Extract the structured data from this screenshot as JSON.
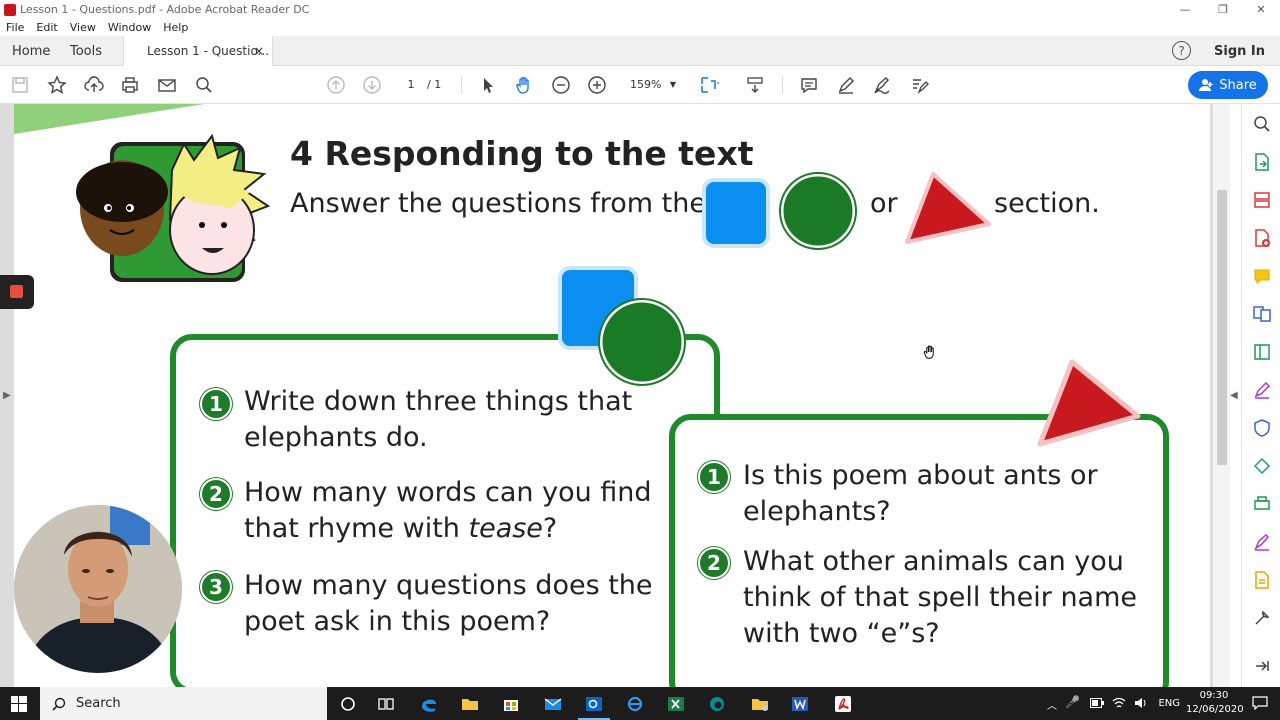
{
  "window": {
    "title": "Lesson 1 - Questions.pdf - Adobe Acrobat Reader DC",
    "minimize": "—",
    "restore": "❐",
    "close": "✕"
  },
  "menu": [
    "File",
    "Edit",
    "View",
    "Window",
    "Help"
  ],
  "tabs": {
    "home": "Home",
    "tools": "Tools",
    "document": "Lesson 1 - Questio...",
    "close": "×",
    "help": "?",
    "signin": "Sign In"
  },
  "toolbar": {
    "page_current": "1",
    "page_total": "/ 1",
    "zoom": "159%",
    "share_label": "Share"
  },
  "document": {
    "heading": "4 Responding to the text",
    "instruction": "Answer the questions from the",
    "instruction_or": "or",
    "instruction_end": "section.",
    "left_card": {
      "questions": [
        {
          "num": "1",
          "line1": "Write down three things that",
          "line2": "elephants do."
        },
        {
          "num": "2",
          "line1": "How many words can you find",
          "line2_pre": "that rhyme with ",
          "line2_em": "tease",
          "line2_post": "?"
        },
        {
          "num": "3",
          "line1": "How many questions does the",
          "line2": "poet ask in this poem?"
        }
      ]
    },
    "right_card": {
      "questions": [
        {
          "num": "1",
          "line1": "Is this poem about ants or",
          "line2": "elephants?"
        },
        {
          "num": "2",
          "line1": "What other animals can you",
          "line2": "think of that spell their name",
          "line3": "with two “e”s?"
        }
      ]
    }
  },
  "taskbar": {
    "search_placeholder": "Search",
    "language": "ENG",
    "time": "09:30",
    "date": "12/06/2020"
  },
  "colors": {
    "blue_square": "#0a8ff0",
    "green_circle": "#1a7a25",
    "red_triangle": "#c8191e",
    "card_border": "#1f8a2b",
    "share": "#1473e6"
  }
}
